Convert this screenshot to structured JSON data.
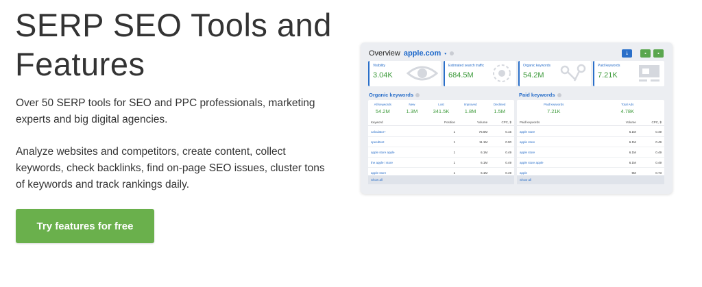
{
  "hero": {
    "title": "SERP SEO Tools and Features",
    "description1": "Over 50 SERP tools for SEO and PPC professionals, marketing experts and big digital agencies.",
    "description2": "Analyze websites and competitors, create content, collect keywords, check backlinks, find on-page SEO issues, cluster tons of keywords and track rankings daily.",
    "cta_label": "Try features for free"
  },
  "dashboard": {
    "title": "Overview",
    "domain": "apple.com",
    "metrics": [
      {
        "label": "Visibility",
        "value": "3.04K"
      },
      {
        "label": "Estimated search traffic",
        "value": "684.5M"
      },
      {
        "label": "Organic keywords",
        "value": "54.2M"
      },
      {
        "label": "Paid keywords",
        "value": "7.21K"
      }
    ],
    "organic": {
      "title": "Organic keywords",
      "stats": [
        {
          "label": "All keywords",
          "value": "54.2M"
        },
        {
          "label": "New",
          "value": "1.3M"
        },
        {
          "label": "Lost",
          "value": "341.5K"
        },
        {
          "label": "Improved",
          "value": "1.8M"
        },
        {
          "label": "Declined",
          "value": "1.5M"
        }
      ],
      "columns": {
        "keyword": "Keyword",
        "position": "Position",
        "volume": "Volume",
        "cpc": "CPC, $"
      },
      "rows": [
        {
          "keyword": "calculator+",
          "position": "1",
          "volume": "75.6M",
          "cpc": "0.15"
        },
        {
          "keyword": "speedtest",
          "position": "1",
          "volume": "11.1M",
          "cpc": "0.00"
        },
        {
          "keyword": "apple store apple",
          "position": "1",
          "volume": "6.1M",
          "cpc": "0.49"
        },
        {
          "keyword": "the apple i store",
          "position": "1",
          "volume": "6.1M",
          "cpc": "0.49"
        },
        {
          "keyword": "apple store",
          "position": "1",
          "volume": "6.1M",
          "cpc": "0.49"
        }
      ],
      "show_all": "Show all"
    },
    "paid": {
      "title": "Paid keywords",
      "stats": [
        {
          "label": "Paid keywords",
          "value": "7.21K"
        },
        {
          "label": "Total Ads",
          "value": "4.78K"
        }
      ],
      "columns": {
        "keyword": "Paid keywords",
        "volume": "Volume",
        "cpc": "CPC, $"
      },
      "rows": [
        {
          "keyword": "apple store",
          "volume": "6.1M",
          "cpc": "0.49"
        },
        {
          "keyword": "apple store",
          "volume": "6.1M",
          "cpc": "0.49"
        },
        {
          "keyword": "apple store",
          "volume": "6.1M",
          "cpc": "0.49"
        },
        {
          "keyword": "apple store apple",
          "volume": "6.1M",
          "cpc": "0.49"
        },
        {
          "keyword": "apple",
          "volume": "5M",
          "cpc": "0.73"
        }
      ],
      "show_all": "Show all"
    }
  },
  "colors": {
    "cta": "#6ab04c",
    "accent_blue": "#2a6fc9",
    "value_green": "#3c9a3a"
  }
}
